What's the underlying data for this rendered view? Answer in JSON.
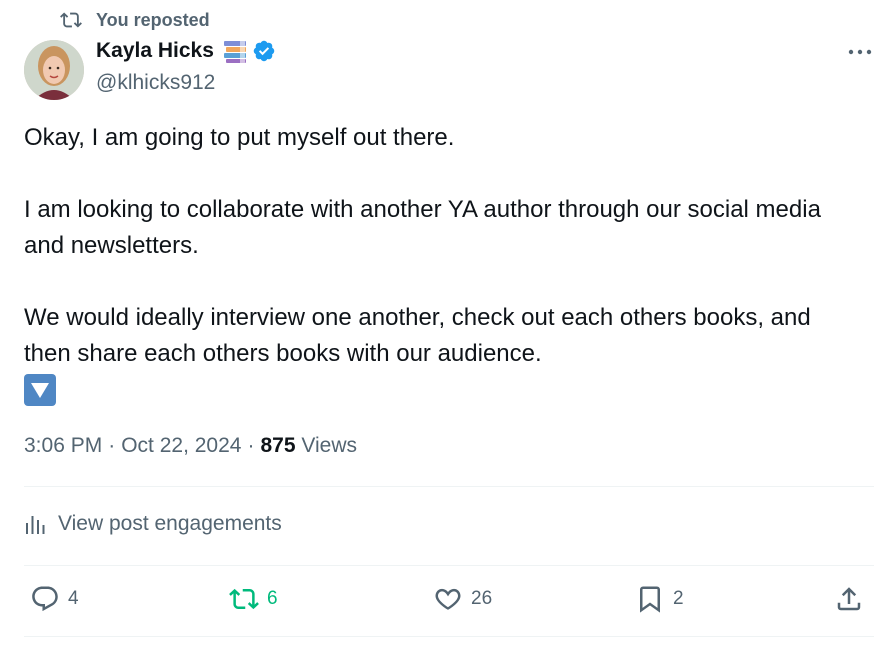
{
  "repost_banner": {
    "label": "You reposted",
    "icon": "repost-icon"
  },
  "author": {
    "name": "Kayla Hicks",
    "handle": "@klhicks912",
    "badges": [
      "books-icon",
      "verified-icon"
    ]
  },
  "tweet": {
    "text": "Okay, I am going to put myself out there.\n\nI am looking to collaborate with another YA author through our social media and newsletters.\n\nWe would ideally interview one another, check out each others books, and then share each others books with our audience.",
    "trailing_emoji": "down-arrow-button-icon"
  },
  "meta": {
    "time": "3:06 PM",
    "date": "Oct 22, 2024",
    "views_count": "875",
    "views_label": "Views"
  },
  "engagements": {
    "label": "View post engagements"
  },
  "actions": {
    "replies": "4",
    "reposts": "6",
    "likes": "26",
    "bookmarks": "2"
  },
  "colors": {
    "repost_green": "#00ba7c",
    "muted": "#536471",
    "verified_blue": "#1d9bf0"
  }
}
